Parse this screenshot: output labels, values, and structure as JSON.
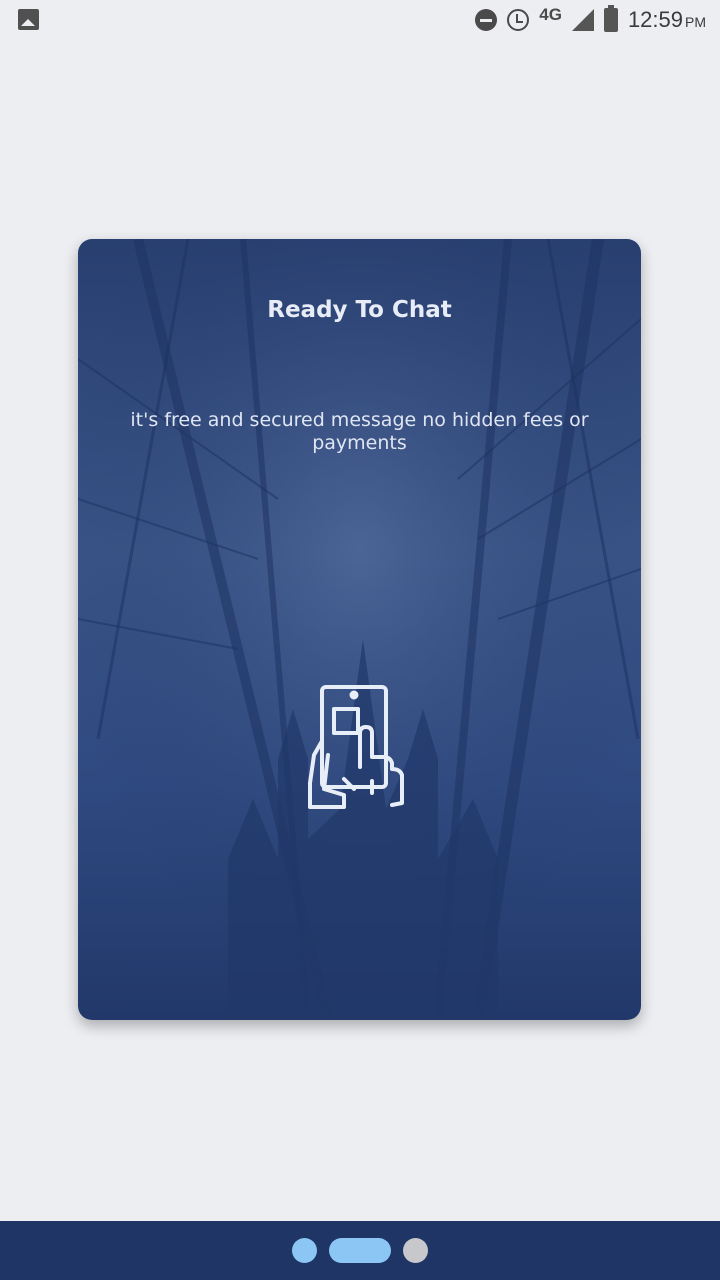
{
  "status_bar": {
    "network": "4G",
    "time": "12:59",
    "ampm": "PM"
  },
  "card": {
    "title": "Ready To Chat",
    "subtitle": "it's free and secured message no hidden fees or payments",
    "illustration_icon": "phone-touch-icon"
  },
  "pager": {
    "page_count": 3,
    "current_page": 2
  },
  "colors": {
    "background": "#eceef2",
    "card": "#2f4a80",
    "bottom_bar": "#1e3566",
    "indicator_active": "#8cc6f4",
    "indicator_inactive": "#c8c8cc"
  }
}
